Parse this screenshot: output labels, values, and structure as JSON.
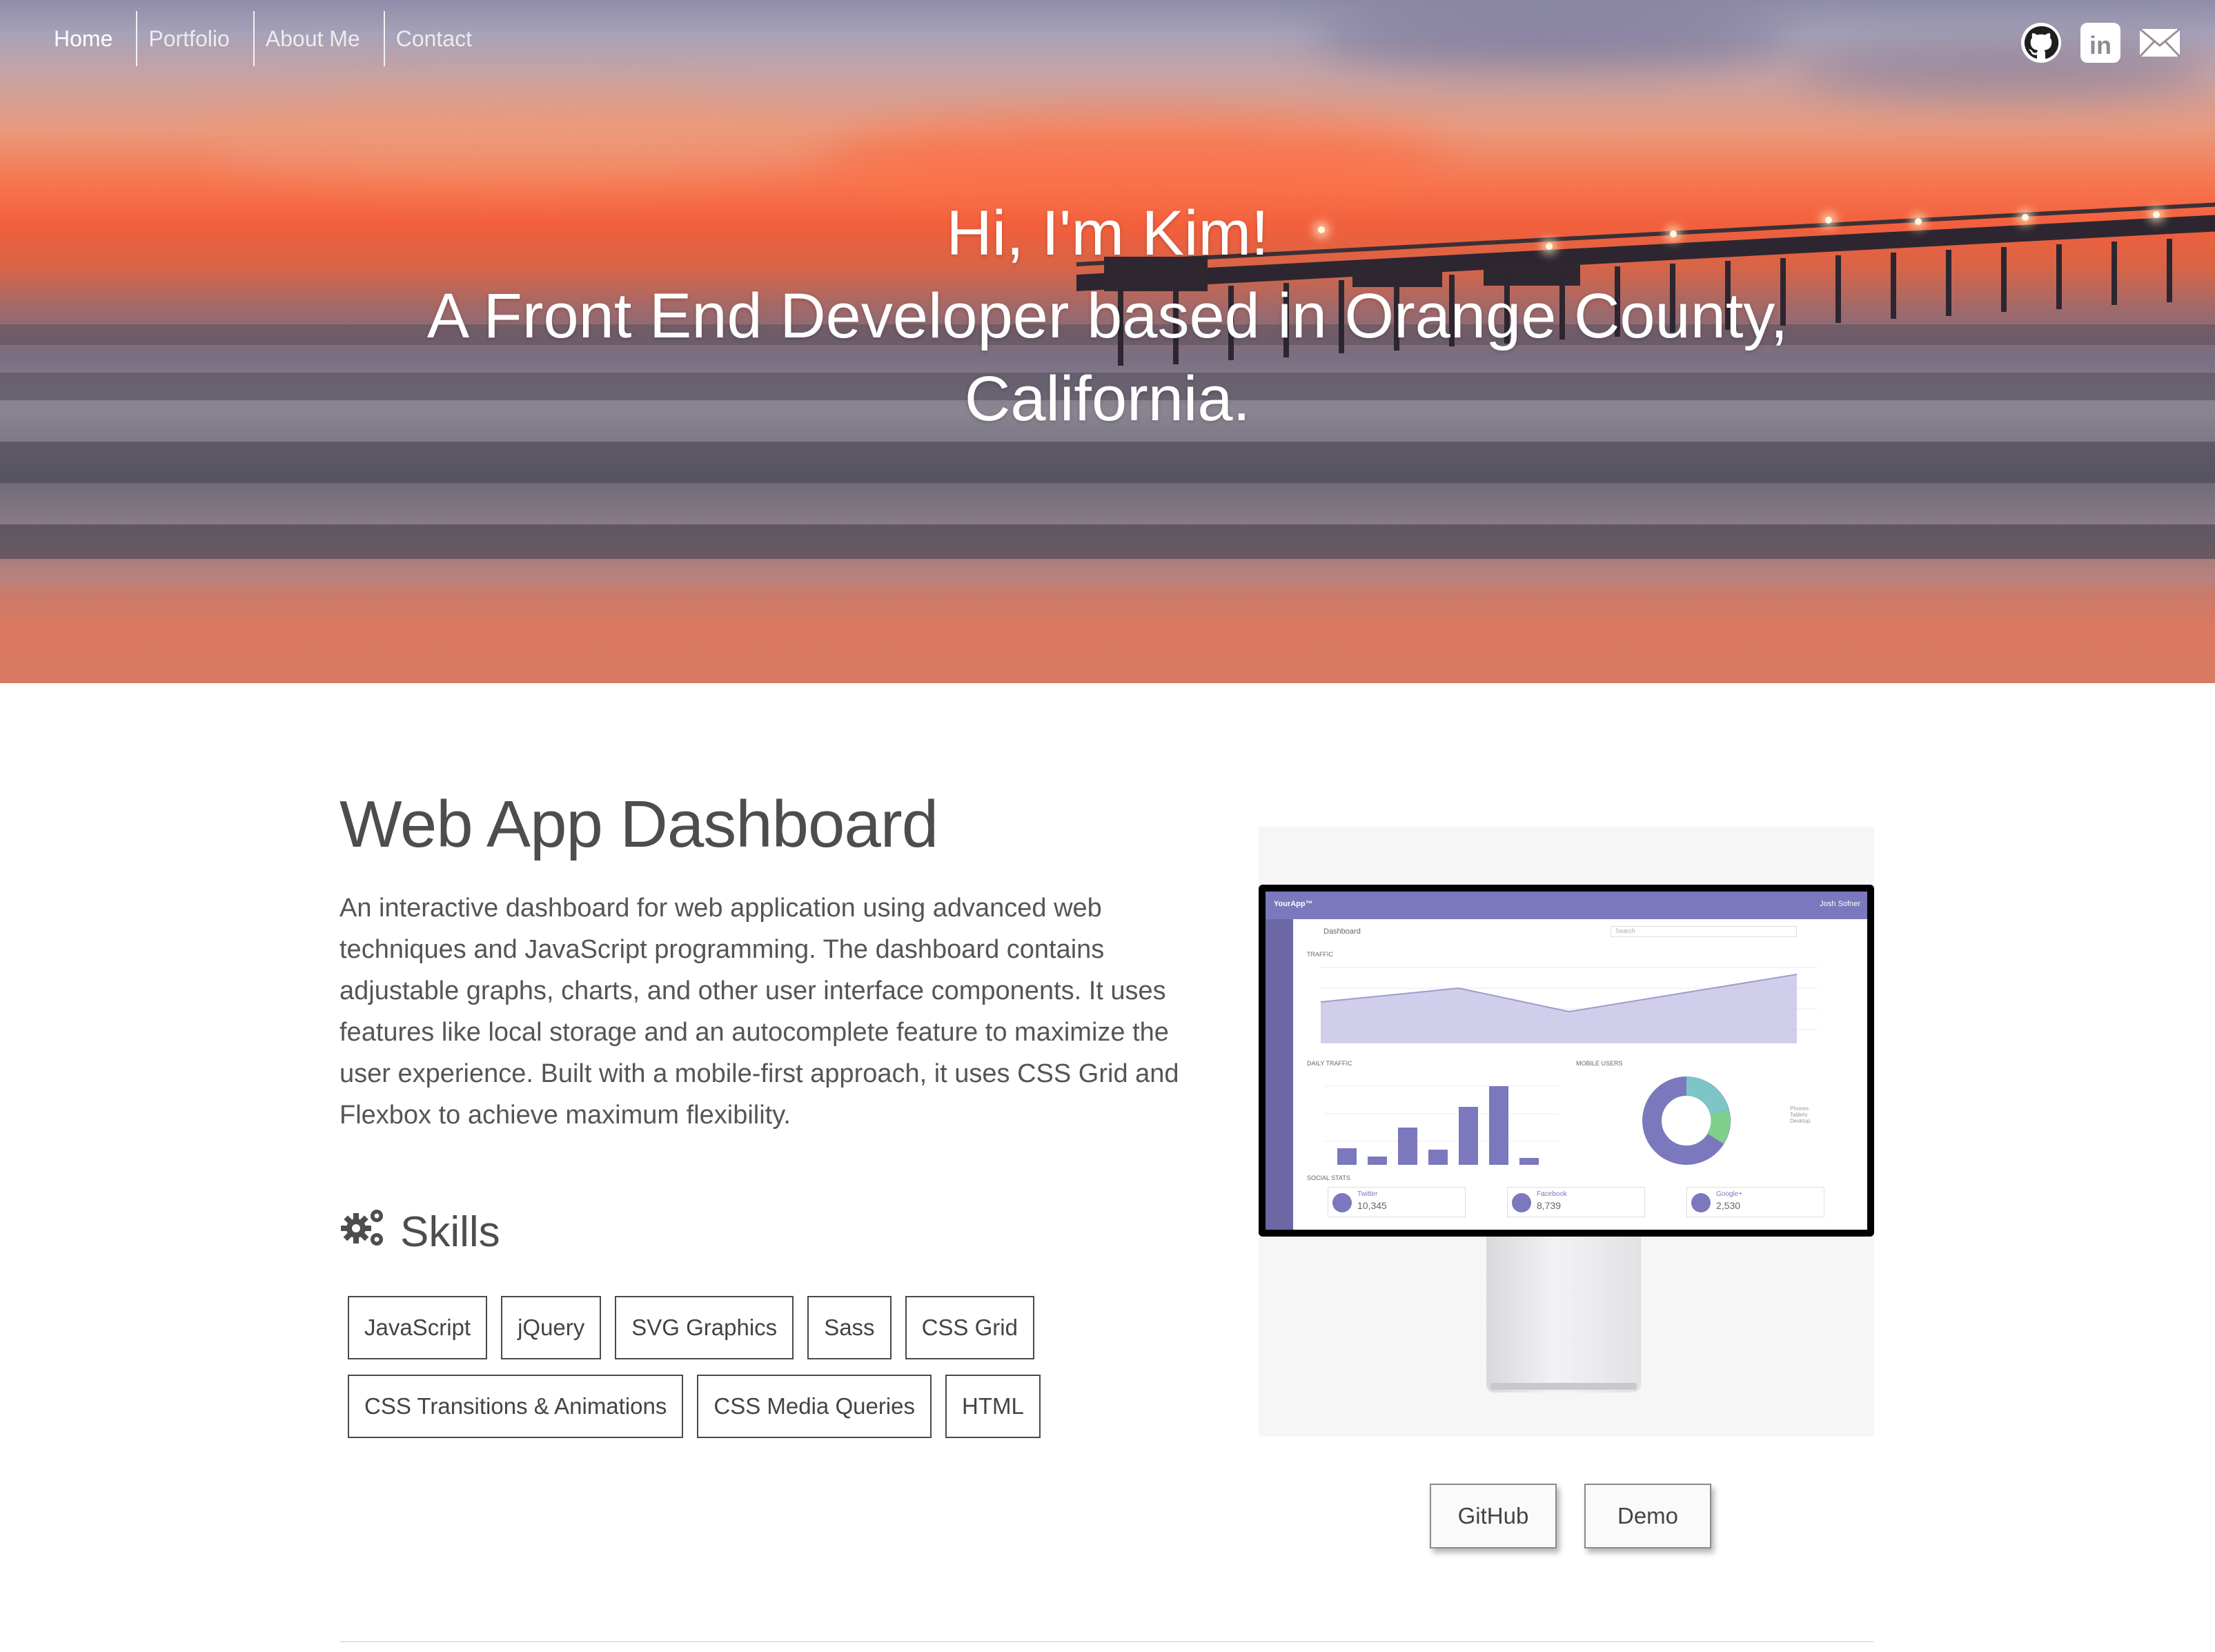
{
  "nav": {
    "items": [
      "Home",
      "Portfolio",
      "About Me",
      "Contact"
    ]
  },
  "social": {
    "icons": [
      "github-icon",
      "linkedin-icon",
      "mail-icon"
    ]
  },
  "hero": {
    "line1": "Hi, I'm Kim!",
    "line2": "A Front End Developer based in Orange County,",
    "line3": "California."
  },
  "project": {
    "title": "Web App Dashboard",
    "description": "An interactive dashboard for web application using advanced web techniques and JavaScript programming. The dashboard contains adjustable graphs, charts, and other user interface components. It uses features like local storage and an autocomplete feature to maximize the user experience. Built with a mobile-first approach, it uses CSS Grid and Flexbox to achieve maximum flexibility.",
    "skills_heading": "Skills",
    "skills": [
      "JavaScript",
      "jQuery",
      "SVG Graphics",
      "Sass",
      "CSS Grid",
      "CSS Transitions & Animations",
      "CSS Media Queries",
      "HTML"
    ],
    "github_label": "GitHub",
    "demo_label": "Demo"
  },
  "dashboard_preview": {
    "app_name": "YourApp™",
    "user": "Josh Sofner",
    "breadcrumb": "Dashboard",
    "search_placeholder": "Search",
    "traffic_label": "TRAFFIC",
    "daily_label": "DAILY TRAFFIC",
    "mobile_label": "MOBILE USERS",
    "social_label": "SOCIAL STATS",
    "social": [
      {
        "name": "Twitter",
        "value": "10,345"
      },
      {
        "name": "Facebook",
        "value": "8,739"
      },
      {
        "name": "Google+",
        "value": "2,530"
      }
    ],
    "legend": [
      "Phones",
      "Tablets",
      "Desktop"
    ]
  },
  "colors": {
    "accent": "#7b78bd",
    "text": "#4a4a4a"
  }
}
